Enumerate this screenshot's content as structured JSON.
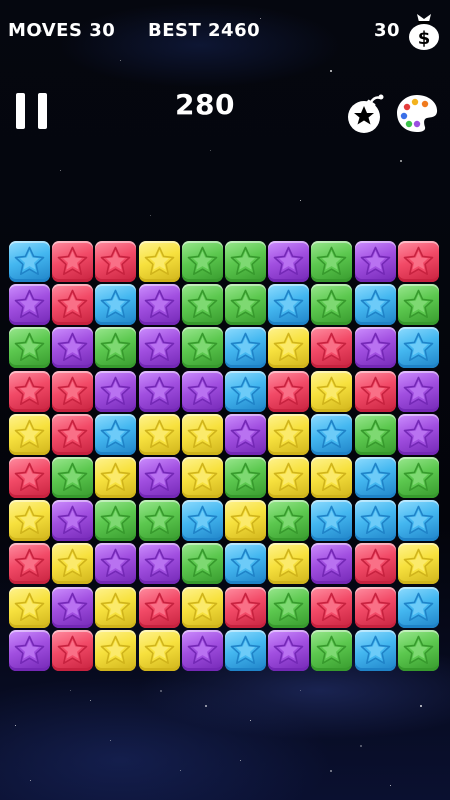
{
  "hud": {
    "moves": "MOVES 30",
    "best": "BEST 2460",
    "coins": "30",
    "score": "280"
  },
  "icons": {
    "pause": "pause-icon",
    "money": "money-bag-icon",
    "bomb": "bomb-star-icon",
    "palette": "palette-icon"
  },
  "colors": {
    "blue": {
      "face": "#44b7f0",
      "light": "#8fdcff",
      "dark": "#1f83c8"
    },
    "red": {
      "face": "#f24a67",
      "light": "#ff8fa2",
      "dark": "#c7223f"
    },
    "yellow": {
      "face": "#f7e13e",
      "light": "#fff38f",
      "dark": "#d0b41b"
    },
    "green": {
      "face": "#5cc84f",
      "light": "#9ae88f",
      "dark": "#379a2d"
    },
    "purple": {
      "face": "#a14fe0",
      "light": "#cd8fff",
      "dark": "#7428b6"
    }
  },
  "board": [
    [
      "blue",
      "red",
      "red",
      "yellow",
      "green",
      "green",
      "purple",
      "green",
      "purple",
      "red"
    ],
    [
      "purple",
      "red",
      "blue",
      "purple",
      "green",
      "green",
      "blue",
      "green",
      "blue",
      "green"
    ],
    [
      "green",
      "purple",
      "green",
      "purple",
      "green",
      "blue",
      "yellow",
      "red",
      "purple",
      "blue"
    ],
    [
      "red",
      "red",
      "purple",
      "purple",
      "purple",
      "blue",
      "red",
      "yellow",
      "red",
      "purple"
    ],
    [
      "yellow",
      "red",
      "blue",
      "yellow",
      "yellow",
      "purple",
      "yellow",
      "blue",
      "green",
      "purple"
    ],
    [
      "red",
      "green",
      "yellow",
      "purple",
      "yellow",
      "green",
      "yellow",
      "yellow",
      "blue",
      "green"
    ],
    [
      "yellow",
      "purple",
      "green",
      "green",
      "blue",
      "yellow",
      "green",
      "blue",
      "blue",
      "blue"
    ],
    [
      "red",
      "yellow",
      "purple",
      "purple",
      "green",
      "blue",
      "yellow",
      "purple",
      "red",
      "yellow"
    ],
    [
      "yellow",
      "purple",
      "yellow",
      "red",
      "yellow",
      "red",
      "green",
      "red",
      "red",
      "blue"
    ],
    [
      "purple",
      "red",
      "yellow",
      "yellow",
      "purple",
      "blue",
      "purple",
      "green",
      "blue",
      "green"
    ]
  ]
}
